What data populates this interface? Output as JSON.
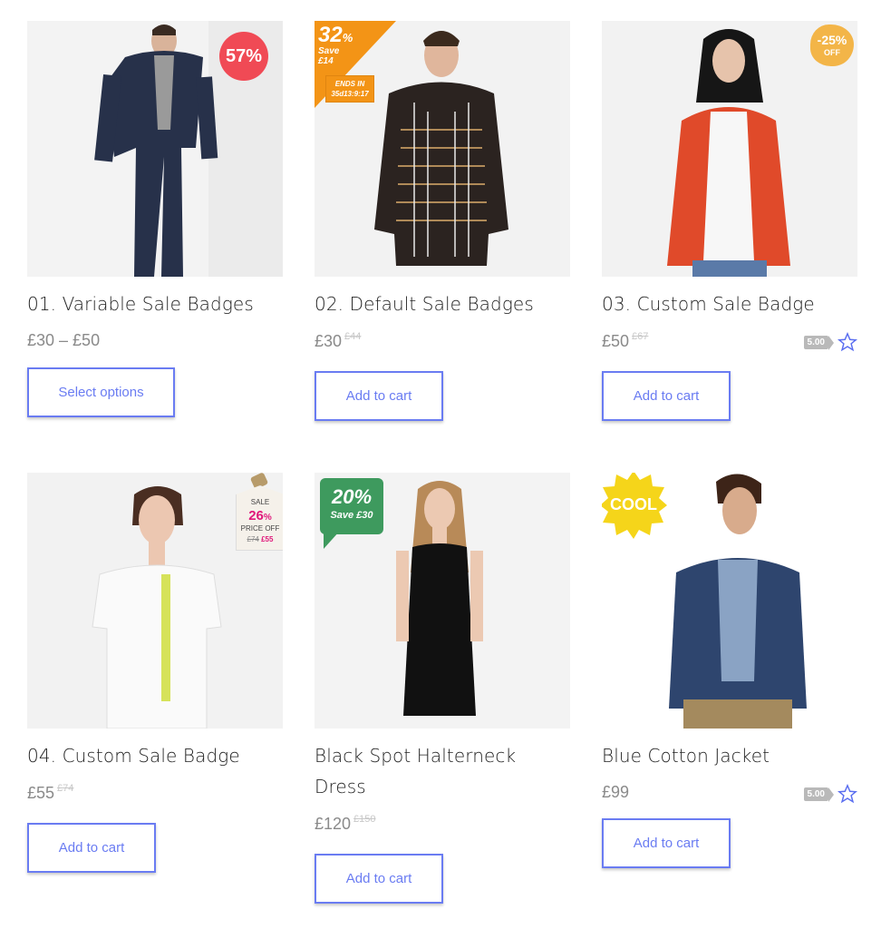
{
  "products": [
    {
      "title": "01. Variable Sale Badges",
      "price": "£30 – £50",
      "old_price": "",
      "button": "Select options",
      "badge": {
        "type": "circle",
        "text": "57%",
        "color": "#f04a55"
      }
    },
    {
      "title": "02. Default Sale Badges",
      "price": "£30",
      "old_price": "£44",
      "button": "Add to cart",
      "badge": {
        "type": "corner",
        "percent": "32",
        "percent_sign": "%",
        "save": "Save",
        "save_amount": "£14",
        "ends": "ENDS IN",
        "countdown": "35d13:9:17",
        "color": "#f39416"
      }
    },
    {
      "title": "03. Custom Sale Badge",
      "price": "£50",
      "old_price": "£67",
      "button": "Add to cart",
      "rating": "5.00",
      "badge": {
        "type": "blob",
        "text": "-25%",
        "sub": "OFF",
        "color": "#f3b548"
      }
    },
    {
      "title": "04. Custom Sale Badge",
      "price": "£55",
      "old_price": "£74",
      "button": "Add to cart",
      "badge": {
        "type": "tag",
        "top": "SALE",
        "percent": "26",
        "percent_sign": "%",
        "mid": "PRICE OFF",
        "was": "£74",
        "now": "£55",
        "color": "#e0187a"
      }
    },
    {
      "title": "Black Spot Halterneck Dress",
      "price": "£120",
      "old_price": "£150",
      "button": "Add to cart",
      "badge": {
        "type": "speech",
        "text": "20%",
        "sub": "Save £30",
        "color": "#3e9a5e"
      }
    },
    {
      "title": "Blue Cotton Jacket",
      "price": "£99",
      "old_price": "",
      "button": "Add to cart",
      "rating": "5.00",
      "badge": {
        "type": "burst",
        "text": "COOL",
        "color": "#f5d51a"
      }
    }
  ]
}
